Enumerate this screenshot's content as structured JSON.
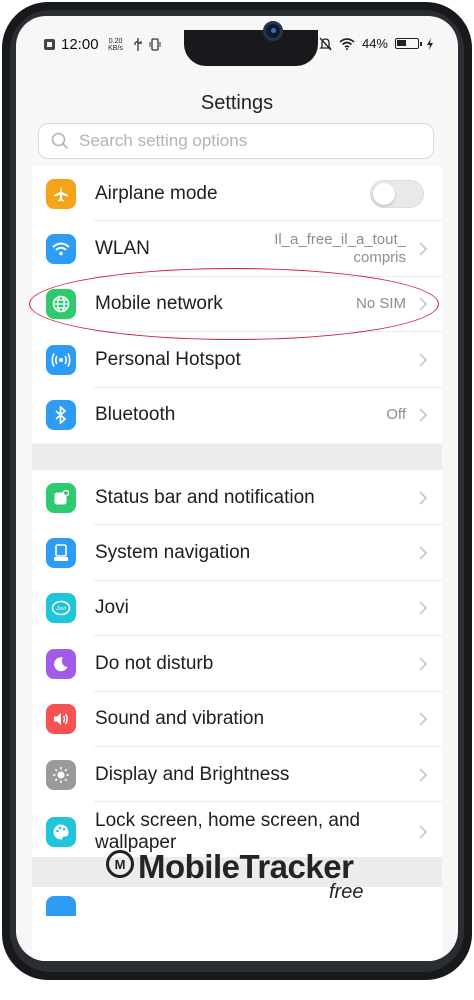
{
  "status_bar": {
    "time": "12:00",
    "speed_value": "0.20",
    "speed_unit": "KB/s",
    "battery_percent": "44%",
    "left_icons": [
      "close-box-icon",
      "usb-icon",
      "vibrate-icon"
    ],
    "right_icons": [
      "mute-icon",
      "wifi-icon",
      "battery-icon",
      "charging-icon"
    ]
  },
  "header": {
    "title": "Settings"
  },
  "search": {
    "placeholder": "Search setting options"
  },
  "group1": [
    {
      "label": "Airplane mode",
      "icon": "airplane-icon",
      "color": "#f7a21b",
      "toggle": false
    },
    {
      "label": "WLAN",
      "icon": "wifi-icon",
      "color": "#2d9cf5",
      "value_line1": "Il_a_free_il_a_tout_",
      "value_line2": "compris"
    },
    {
      "label": "Mobile network",
      "icon": "globe-icon",
      "color": "#2fc970",
      "value_line1": "No SIM"
    },
    {
      "label": "Personal Hotspot",
      "icon": "hotspot-icon",
      "color": "#2d9cf5"
    },
    {
      "label": "Bluetooth",
      "icon": "bluetooth-icon",
      "color": "#2d9cf5",
      "value_line1": "Off"
    }
  ],
  "group2": [
    {
      "label": "Status bar and notification",
      "icon": "notification-icon",
      "color": "#2fc970"
    },
    {
      "label": "System navigation",
      "icon": "navigation-icon",
      "color": "#2d9cf5"
    },
    {
      "label": "Jovi",
      "icon": "jovi-icon",
      "color": "#20c6d8",
      "badge": "Jovi"
    },
    {
      "label": "Do not disturb",
      "icon": "moon-icon",
      "color": "#a25ae8"
    },
    {
      "label": "Sound and vibration",
      "icon": "speaker-icon",
      "color": "#f55254"
    },
    {
      "label": "Display and Brightness",
      "icon": "brightness-icon",
      "color": "#9a9a9a"
    },
    {
      "label_line1": "Lock screen, home screen, and",
      "label_line2": "wallpaper",
      "icon": "palette-icon",
      "color": "#20c6d8"
    }
  ],
  "watermark": {
    "logo_letter": "M",
    "text": "MobileTracker",
    "sub": "free"
  },
  "colors": {
    "highlight": "#d1213a",
    "chevron": "#c4c4c4"
  }
}
